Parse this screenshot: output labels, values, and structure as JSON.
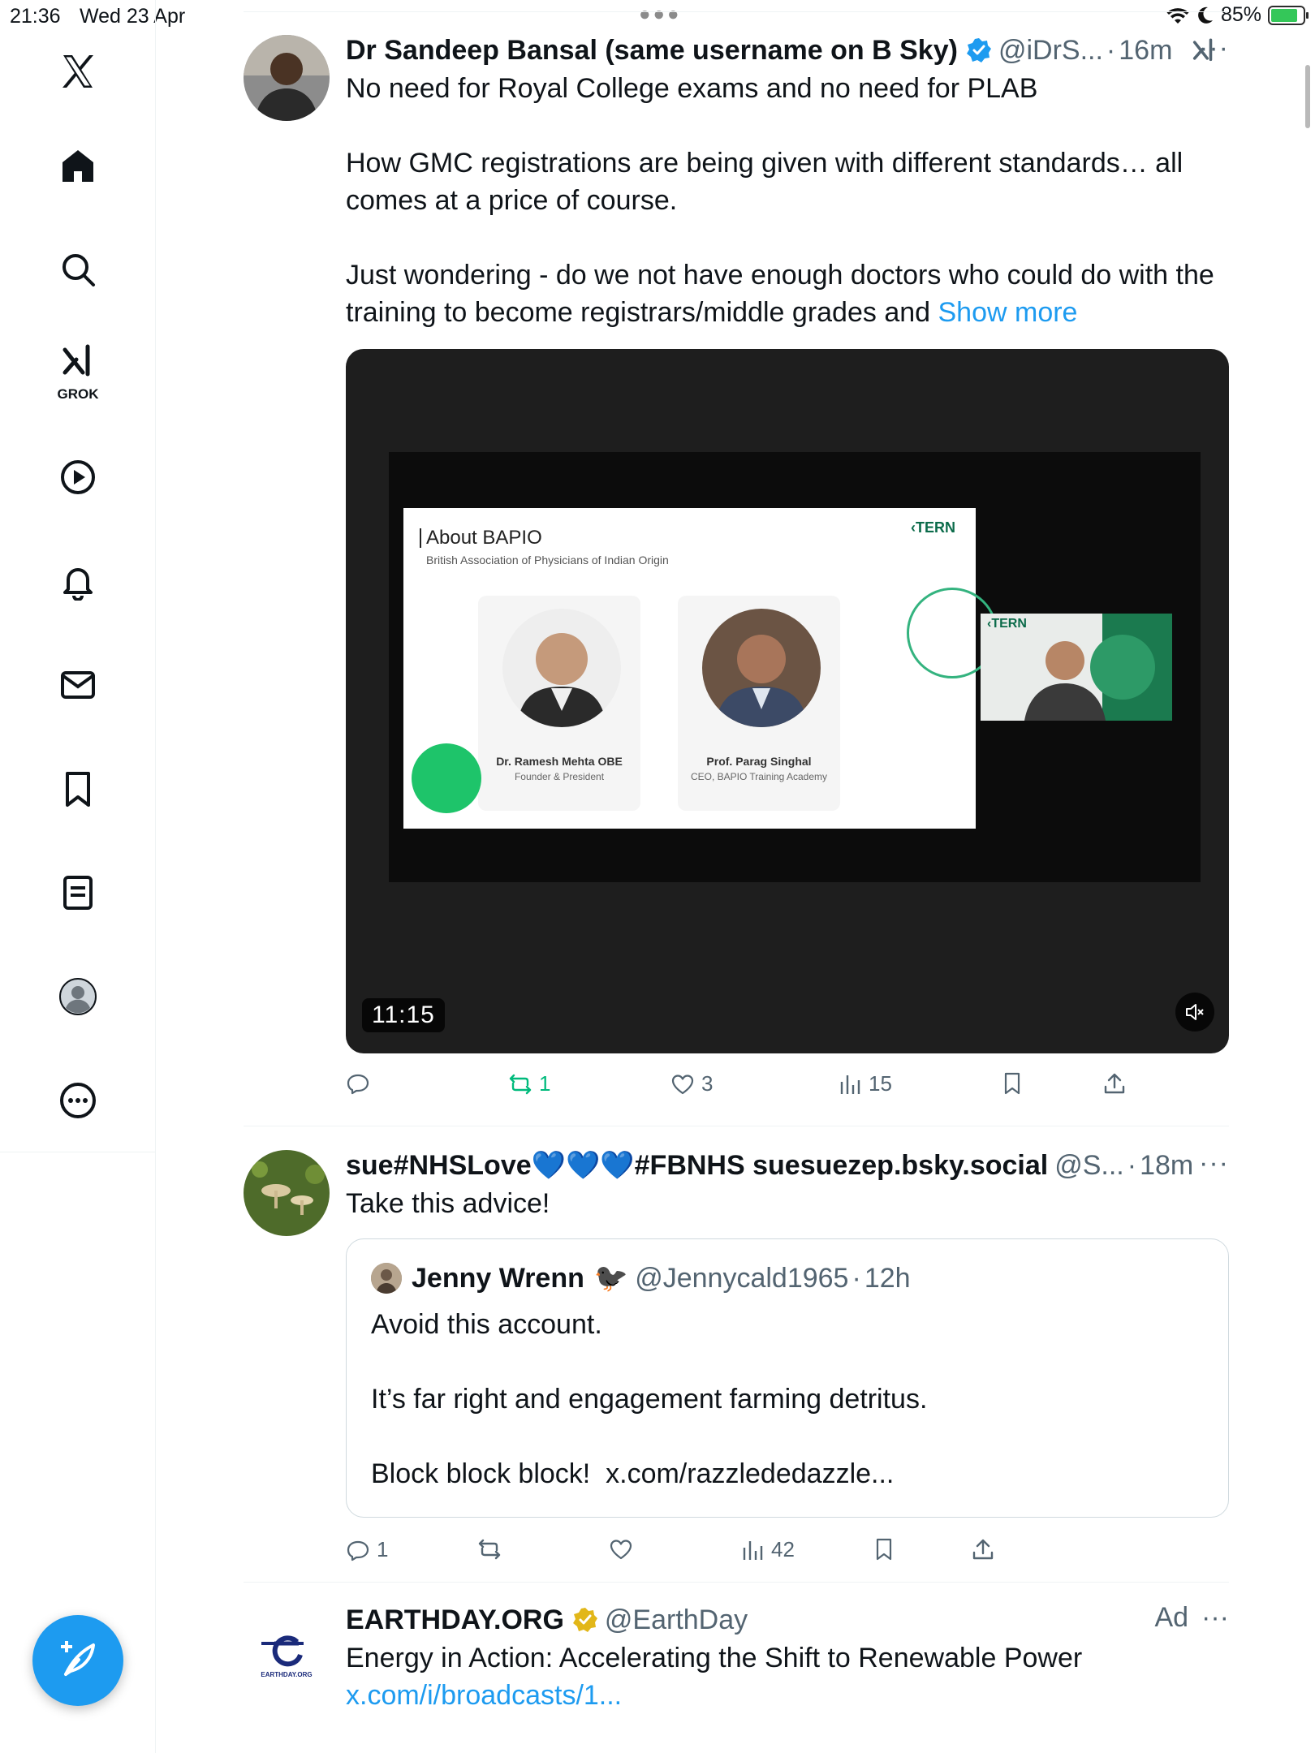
{
  "status_bar": {
    "time": "21:36",
    "date": "Wed 23 Apr",
    "battery": "85%"
  },
  "sidebar": {
    "items": [
      {
        "icon": "x-logo-icon"
      },
      {
        "icon": "home-icon"
      },
      {
        "icon": "search-icon"
      },
      {
        "icon": "grok-icon",
        "label": "GROK"
      },
      {
        "icon": "video-icon"
      },
      {
        "icon": "notifications-icon"
      },
      {
        "icon": "messages-icon"
      },
      {
        "icon": "bookmark-icon"
      },
      {
        "icon": "lists-icon"
      },
      {
        "icon": "profile-icon"
      },
      {
        "icon": "more-icon"
      }
    ],
    "compose_icon": "compose-icon"
  },
  "posts": [
    {
      "name": "Dr Sandeep Bansal (same username on B Sky)",
      "handle": "@iDrS...",
      "time": "16m",
      "text": "No need for Royal College exams and no need for PLAB\n\nHow GMC registrations are being given with different standards… all comes at a price of course.\n\nJust wondering - do we not have enough doctors who could do with the training to become registrars/middle grades and ",
      "show_more": "Show more",
      "video": {
        "duration": "11:15",
        "slide_title": "About BAPIO",
        "slide_subtitle": "British Association of Physicians of Indian Origin",
        "slide_logo": "TERN",
        "speaker_logo": "TERN",
        "cards": [
          {
            "name": "Dr. Ramesh Mehta OBE",
            "title": "Founder & President"
          },
          {
            "name": "Prof. Parag Singhal",
            "title": "CEO, BAPIO Training Academy"
          }
        ]
      },
      "actions": {
        "replies": "",
        "reposts": "1",
        "likes": "3",
        "views": "15"
      }
    },
    {
      "name": "sue#NHSLove💙💙💙#FBNHS suesuezep.bsky.social",
      "handle": "@S...",
      "time": "18m",
      "text": "Take this advice!",
      "quote": {
        "name": "Jenny Wrenn",
        "emoji": "🐦‍⬛",
        "handle": "@Jennycald1965",
        "time": "12h",
        "text": "Avoid this account.\n\nIt’s far right and engagement farming detritus.\n\nBlock block block!  x.com/razzlededazzle..."
      },
      "actions": {
        "replies": "1",
        "reposts": "",
        "likes": "",
        "views": "42"
      }
    },
    {
      "name": "EARTHDAY.ORG",
      "handle": "@EarthDay",
      "ad_label": "Ad",
      "logo_text": "EARTHDAY.ORG",
      "text": "Energy in Action: Accelerating the Shift to Renewable Power",
      "link": "x.com/i/broadcasts/1..."
    }
  ],
  "colors": {
    "accent": "#1d9bf0",
    "repost_active": "#00ba7c",
    "secondary_text": "#536471",
    "verified_gold": "#e2b719"
  }
}
